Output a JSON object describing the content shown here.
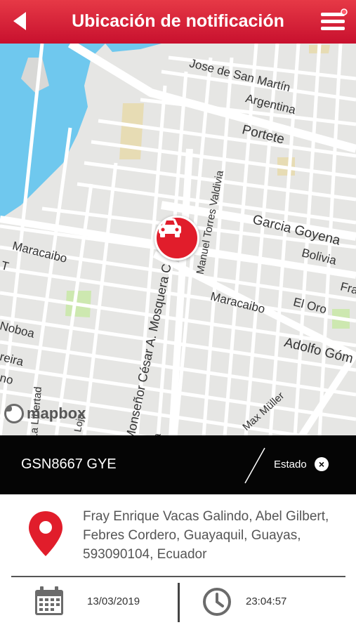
{
  "header": {
    "title": "Ubicación de notificación"
  },
  "map": {
    "streets": [
      "Jose de San Martín",
      "Argentina",
      "Portete",
      "Manuel Torres Valdivia",
      "Garcia Goyena",
      "Bolivia",
      "Maracaibo",
      "Maracaibo",
      "El Oro",
      "Fra",
      "Adolfo Góm",
      "Noboa",
      "reira",
      "no",
      "T",
      "Monseñor César A. Mosquera C",
      "La Libertad",
      "Max Müller",
      "Loja",
      "ia"
    ],
    "attribution": "mapbox",
    "marker_icon": "car-icon"
  },
  "vehicle": {
    "plate": "GSN8667 GYE",
    "status_label": "Estado",
    "status_icon": "close-icon"
  },
  "location": {
    "address": "Fray Enrique Vacas Galindo, Abel Gilbert, Febres Cordero, Guayaquil, Guayas, 593090104, Ecuador"
  },
  "datetime": {
    "date": "13/03/2019",
    "time": "23:04:57"
  },
  "colors": {
    "header_red": "#d7142b",
    "marker_red": "#e11d2b",
    "water": "#6fc8ee",
    "park": "#cde8b0",
    "sand": "#e7dcb4"
  }
}
